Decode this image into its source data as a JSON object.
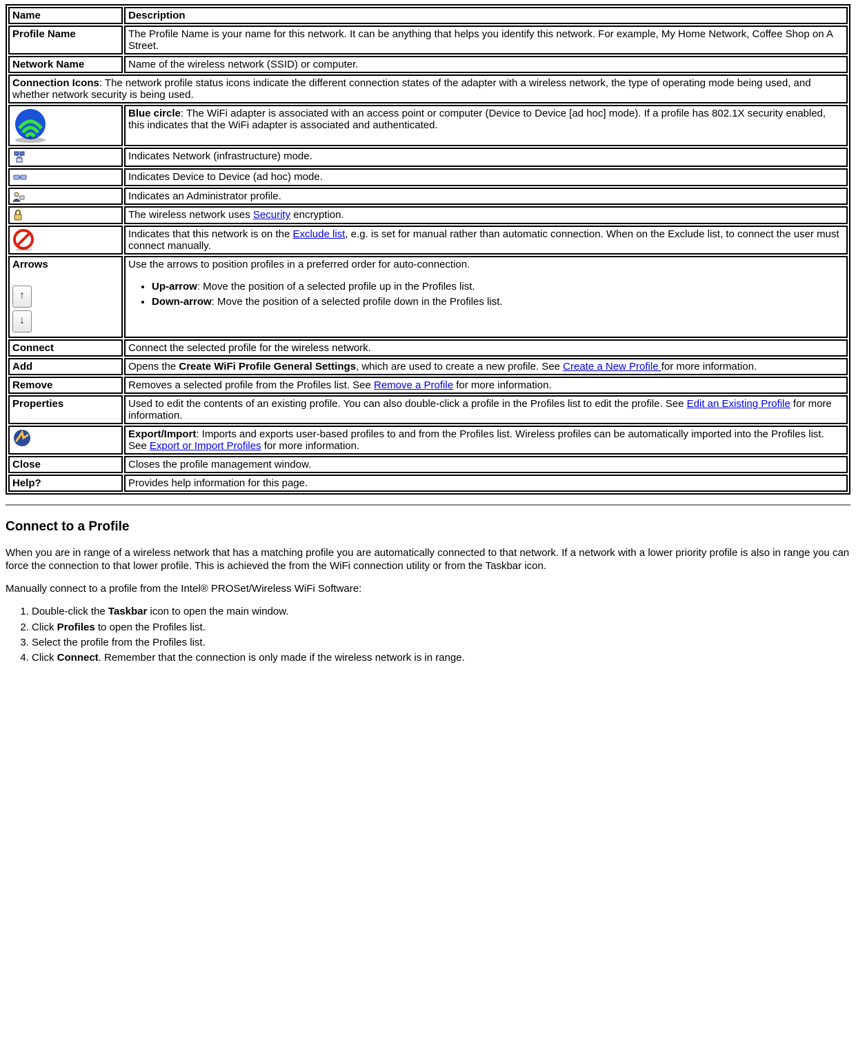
{
  "headers": {
    "name": "Name",
    "desc": "Description"
  },
  "rows": {
    "profile_name": {
      "name": "Profile Name",
      "desc": "The Profile Name is your name for this network. It can be anything that helps you identify this network. For example, My Home Network, Coffee Shop on A Street."
    },
    "network_name": {
      "name": "Network Name",
      "desc": "Name of the wireless network (SSID) or computer."
    },
    "conn_icons": {
      "label": "Connection Icons",
      "desc": ": The network profile status icons indicate the different connection states of the adapter with a wireless network, the type of operating mode being used, and whether network security is being used."
    },
    "blue_circle": {
      "label": "Blue circle",
      "desc": ": The WiFi adapter is associated with an access point or computer (Device to Device [ad hoc] mode). If a profile has 802.1X security enabled, this indicates that the WiFi adapter is associated and authenticated."
    },
    "infra": "Indicates Network (infrastructure) mode.",
    "adhoc": "Indicates Device to Device (ad hoc) mode.",
    "admin": "Indicates an Administrator profile.",
    "security_pre": "The wireless network uses ",
    "security_link": "Security",
    "security_post": " encryption.",
    "exclude_pre": "Indicates that this network is on the ",
    "exclude_link": "Exclude list",
    "exclude_post": ", e.g. is set for manual rather than automatic connection. When on the Exclude list, to connect the user must connect manually.",
    "arrows": {
      "name": "Arrows",
      "desc": "Use the arrows to position profiles in a preferred order for auto-connection.",
      "up_label": "Up-arrow",
      "up_desc": ": Move the position of a selected profile up in the Profiles list.",
      "down_label": "Down-arrow",
      "down_desc": ": Move the position of a selected profile down in the Profiles list."
    },
    "connect": {
      "name": "Connect",
      "desc": "Connect the selected profile for the wireless network."
    },
    "add": {
      "name": "Add",
      "pre": "Opens the ",
      "bold": "Create WiFi Profile General Settings",
      "mid": ", which are used to create a new profile. See ",
      "link": "Create a New Profile ",
      "post": "for more information."
    },
    "remove": {
      "name": "Remove",
      "pre": "Removes a selected profile from the Profiles list. See ",
      "link": "Remove a Profile",
      "post": " for more information."
    },
    "properties": {
      "name": "Properties",
      "pre": "Used to edit the contents of an existing profile. You can also double-click a profile in the Profiles list to edit the profile. See ",
      "link": "Edit an Existing Profile",
      "post": " for more information."
    },
    "export": {
      "label": "Export/Import",
      "pre": ": Imports and exports user-based profiles to and from the Profiles list. Wireless profiles can be automatically imported into the Profiles list. See ",
      "link": "Export or Import Profiles",
      "post": " for more information."
    },
    "close": {
      "name": "Close",
      "desc": "Closes the profile management window."
    },
    "help": {
      "name": "Help?",
      "desc": "Provides help information for this page."
    }
  },
  "section": {
    "title": "Connect to a Profile",
    "p1": "When you are in range of a wireless network that has a matching profile you are automatically connected to that network. If a network with a lower priority profile is also in range you can force the connection to that lower profile. This is achieved the from the WiFi connection utility or from the Taskbar icon.",
    "p2": "Manually connect to a profile from the Intel® PROSet/Wireless WiFi Software:",
    "steps": {
      "s1_pre": "Double-click the ",
      "s1_b": "Taskbar",
      "s1_post": " icon to open the main window.",
      "s2_pre": "Click ",
      "s2_b": "Profiles",
      "s2_post": " to open the Profiles list.",
      "s3": "Select the profile from the Profiles list.",
      "s4_pre": "Click ",
      "s4_b": "Connect",
      "s4_post": ". Remember that the connection is only made if the wireless network is in range."
    }
  }
}
